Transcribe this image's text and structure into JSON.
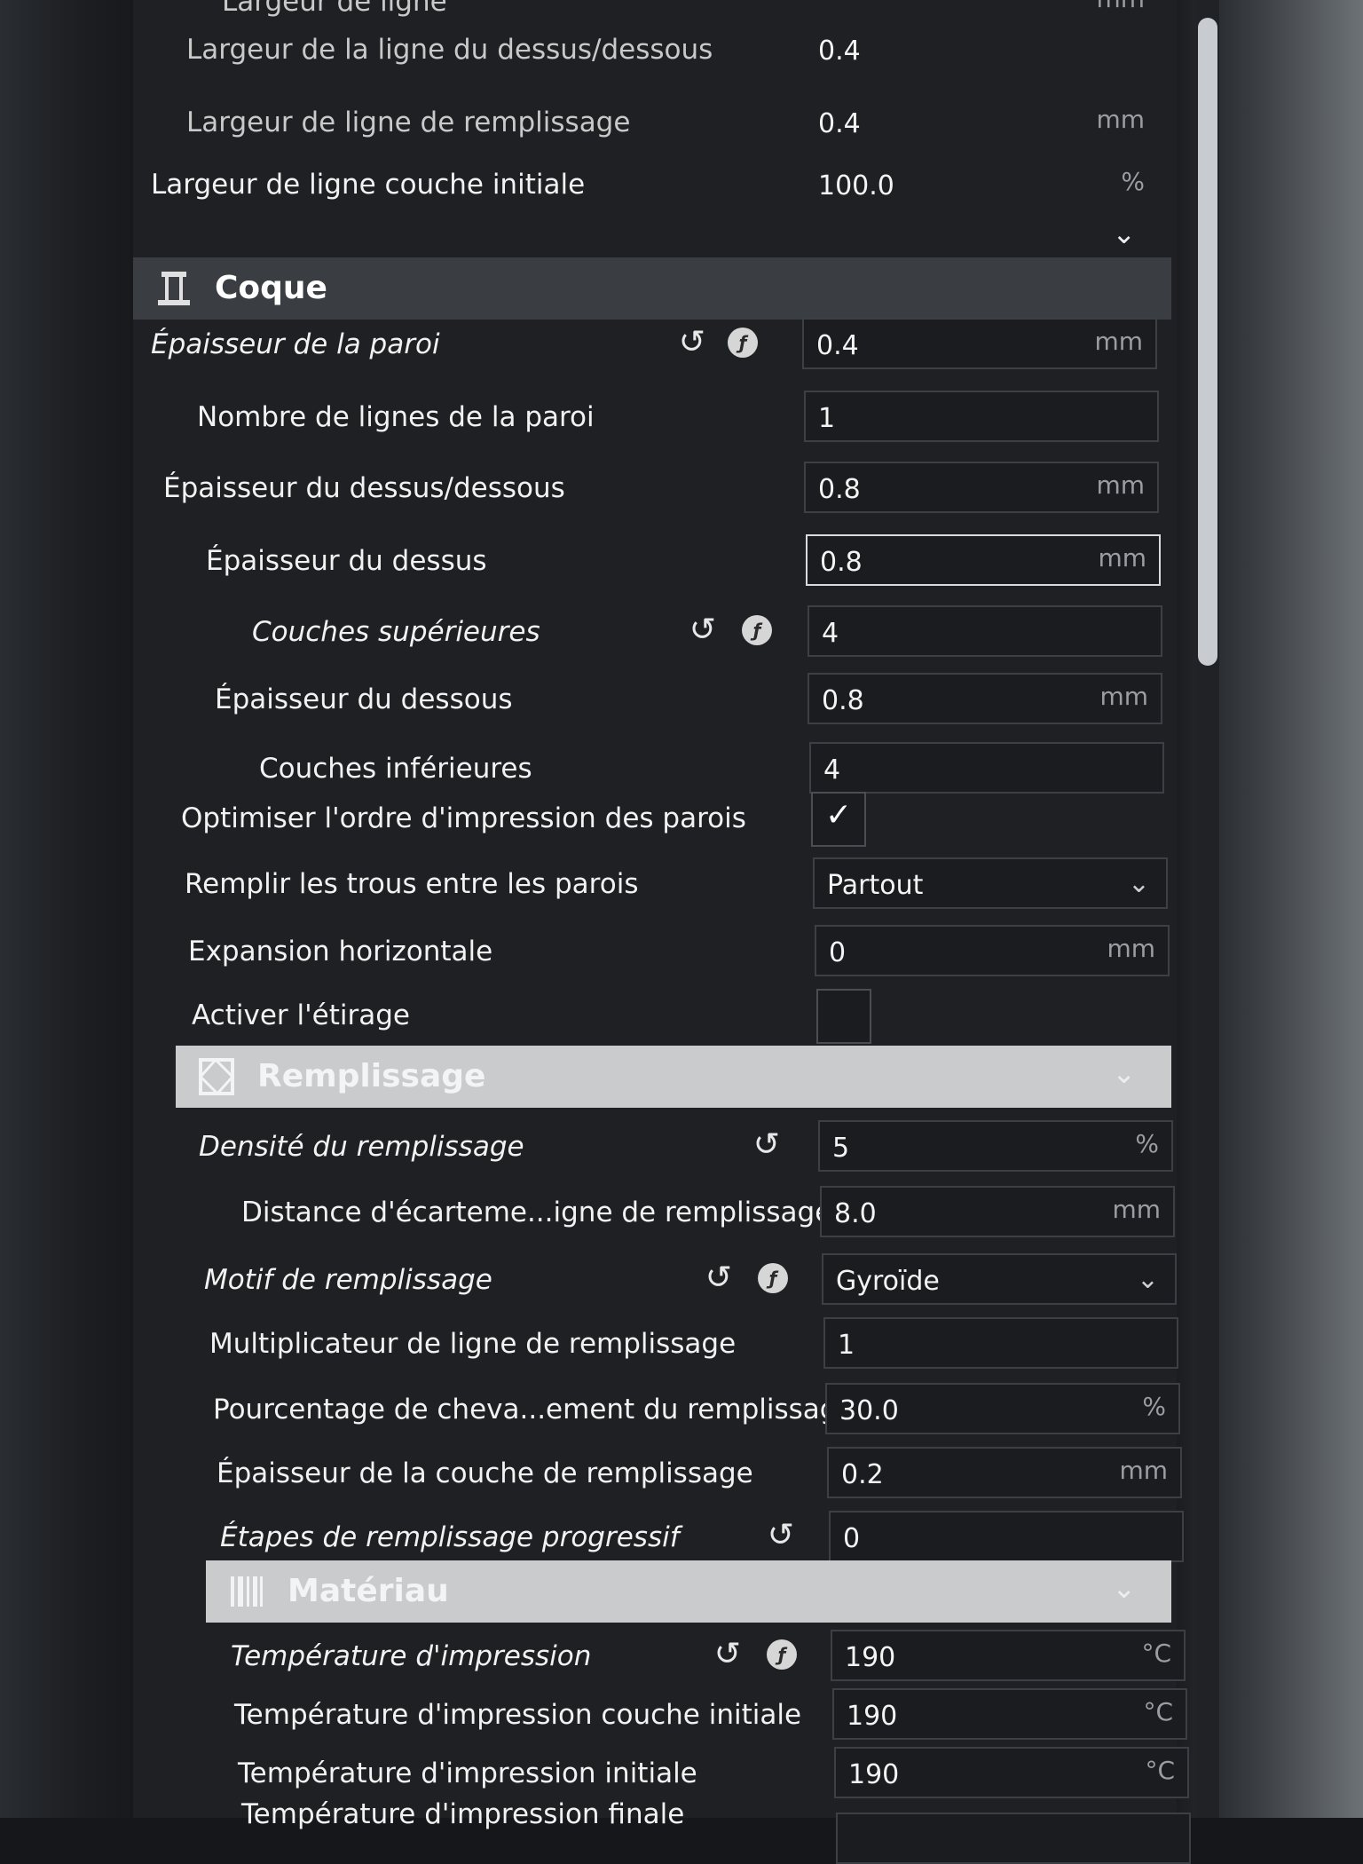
{
  "top_rows": [
    {
      "label": "Largeur de ligne",
      "value": "",
      "unit": "mm"
    },
    {
      "label": "Largeur de la ligne du dessus/dessous",
      "value": "0.4",
      "unit": ""
    },
    {
      "label": "Largeur de ligne de remplissage",
      "value": "0.4",
      "unit": "mm"
    },
    {
      "label": "Largeur de ligne couche initiale",
      "value": "100.0",
      "unit": "%"
    }
  ],
  "sections": {
    "shell": {
      "title": "Coque"
    },
    "infill": {
      "title": "Remplissage"
    },
    "material": {
      "title": "Matériau"
    }
  },
  "shell_rows": [
    {
      "label": "Épaisseur de la paroi",
      "value": "0.4",
      "unit": "mm"
    },
    {
      "label": "Nombre de lignes de la paroi",
      "value": "1",
      "unit": ""
    },
    {
      "label": "Épaisseur du dessus/dessous",
      "value": "0.8",
      "unit": "mm"
    },
    {
      "label": "Épaisseur du dessus",
      "value": "0.8",
      "unit": "mm"
    },
    {
      "label": "Couches supérieures",
      "value": "4",
      "unit": ""
    },
    {
      "label": "Épaisseur du dessous",
      "value": "0.8",
      "unit": "mm"
    },
    {
      "label": "Couches inférieures",
      "value": "4",
      "unit": ""
    },
    {
      "label": "Optimiser l'ordre d'impression des parois",
      "checked": true
    },
    {
      "label": "Remplir les trous entre les parois",
      "value": "Partout"
    },
    {
      "label": "Expansion horizontale",
      "value": "0",
      "unit": "mm"
    },
    {
      "label": "Activer l'étirage",
      "checked": false
    }
  ],
  "infill_rows": [
    {
      "label": "Densité du remplissage",
      "value": "5",
      "unit": "%"
    },
    {
      "label": "Distance d'écarteme...igne de remplissage",
      "value": "8.0",
      "unit": "mm"
    },
    {
      "label": "Motif de remplissage",
      "value": "Gyroïde"
    },
    {
      "label": "Multiplicateur de ligne de remplissage",
      "value": "1",
      "unit": ""
    },
    {
      "label": "Pourcentage de cheva...ement du remplissage",
      "value": "30.0",
      "unit": "%"
    },
    {
      "label": "Épaisseur de la couche de remplissage",
      "value": "0.2",
      "unit": "mm"
    },
    {
      "label": "Étapes de remplissage progressif",
      "value": "0",
      "unit": ""
    }
  ],
  "material_rows": [
    {
      "label": "Température d'impression",
      "value": "190",
      "unit": "°C"
    },
    {
      "label": "Température d'impression couche initiale",
      "value": "190",
      "unit": "°C"
    },
    {
      "label": "Température d'impression initiale",
      "value": "190",
      "unit": "°C"
    },
    {
      "label": "Température d'impression finale",
      "value": "",
      "unit": ""
    }
  ],
  "icons": {
    "reset": "reset-icon",
    "formula": "fx-icon"
  },
  "colors": {
    "panel": "#1e2023",
    "section_dark": "#3a3d41",
    "section_light": "#c9cbcd"
  }
}
